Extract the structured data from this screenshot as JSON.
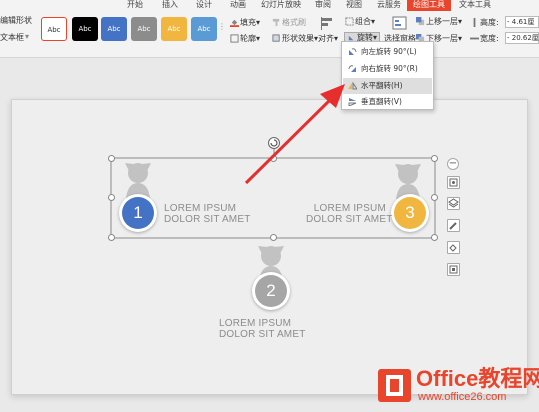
{
  "tabs": [
    "开始",
    "插入",
    "设计",
    "动画",
    "幻灯片放映",
    "审阅",
    "视图",
    "云服务",
    "绘图工具",
    "文本工具"
  ],
  "ribbon": {
    "edit_shape": "编辑形状",
    "text_box": "文本框",
    "style_label": "Abc",
    "fill": "填充",
    "format_brush": "格式刷",
    "outline": "轮廓",
    "shape_effect": "形状效果",
    "align": "对齐",
    "group": "组合",
    "rotate": "旋转",
    "selection_pane": "选择窗格",
    "bring_forward": "上移一层",
    "send_backward": "下移一层",
    "height_label": "高度:",
    "height_value": "4.61厘",
    "width_label": "宽度:",
    "width_value": "20.62厘"
  },
  "rotate_menu": {
    "items": [
      "向左旋转 90°(L)",
      "向右旋转 90°(R)",
      "水平翻转(H)",
      "垂直翻转(V)"
    ]
  },
  "slide": {
    "items": [
      {
        "number": "1",
        "line1": "LOREM IPSUM",
        "line2": "DOLOR SIT AMET"
      },
      {
        "number": "3",
        "line1": "LOREM IPSUM",
        "line2": "DOLOR SIT AMET"
      },
      {
        "number": "2",
        "line1": "LOREM IPSUM",
        "line2": "DOLOR SIT AMET"
      }
    ]
  },
  "watermark": {
    "text": "Office教程网",
    "url": "www.office26.com"
  },
  "colors": {
    "accent": "#e8452c",
    "blue": "#4472c4",
    "yellow": "#f0b63f",
    "gray": "#a6a6a6"
  }
}
